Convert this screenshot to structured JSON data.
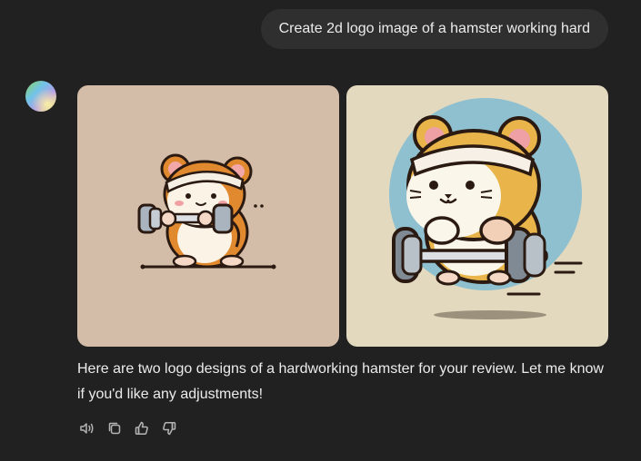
{
  "user_message": {
    "text": "Create 2d logo image of a hamster working hard"
  },
  "assistant": {
    "avatar_icon": "assistant-gradient-avatar",
    "images": [
      {
        "icon": "hamster-dumbbell-logo"
      },
      {
        "icon": "hamster-barbell-logo"
      }
    ],
    "response_text": "Here are two logo designs of a hardworking hamster for your review. Let me know if you'd like any adjustments!",
    "actions": [
      {
        "icon": "speaker-icon"
      },
      {
        "icon": "copy-icon"
      },
      {
        "icon": "thumbs-up-icon"
      },
      {
        "icon": "thumbs-down-icon"
      }
    ]
  },
  "colors": {
    "background": "#212121",
    "bubble": "#2f2f2f",
    "text": "#ececec",
    "icon": "#b4b4b4"
  }
}
